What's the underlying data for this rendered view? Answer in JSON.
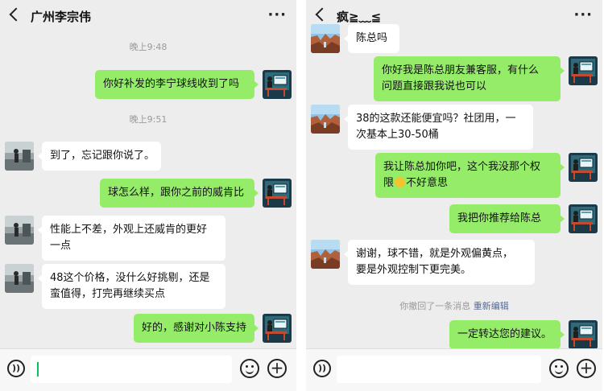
{
  "left_chat": {
    "title": "广州李宗伟",
    "more_label": "···",
    "timestamp_1": "晚上9:48",
    "timestamp_2": "晚上9:51",
    "messages": [
      {
        "text": "你好补发的李宁球线收到了吗"
      },
      {
        "text": "到了，忘记跟你说了。"
      },
      {
        "text": "球怎么样，跟你之前的威肯比"
      },
      {
        "text": "性能上不差，外观上还威肯的更好\n一点"
      },
      {
        "text": "48这个价格，没什么好挑剔，还是\n蛮值得，打完再继续买点"
      },
      {
        "text": "好的，感谢对小陈支持"
      }
    ]
  },
  "right_chat": {
    "title": "疯≧﹏≦",
    "more_label": "···",
    "messages": [
      {
        "text": "陈总吗"
      },
      {
        "text": "你好我是陈总朋友兼客服，有什么\n问题直接跟我说也可以"
      },
      {
        "text": "38的这款还能便宜吗？社团用，一\n次基本上30-50桶"
      },
      {
        "text_before": "我让陈总加你吧，这个我没那个权\n限",
        "text_after": "不好意思"
      },
      {
        "text": "我把你推荐给陈总"
      },
      {
        "text": "谢谢，球不错，就是外观偏黄点，\n要是外观控制下更完美。"
      },
      {
        "text": "一定转达您的建议。"
      }
    ],
    "recall_notice": "你撤回了一条消息",
    "reedit_label": "重新编辑"
  },
  "input_bar": {
    "voice_icon": "voice-icon",
    "emoji_icon": "emoji-icon",
    "plus_icon": "plus-icon"
  },
  "colors": {
    "background": "#ededed",
    "outgoing_bubble": "#95ec69",
    "incoming_bubble": "#ffffff",
    "link": "#576b95",
    "caret": "#07c160"
  }
}
